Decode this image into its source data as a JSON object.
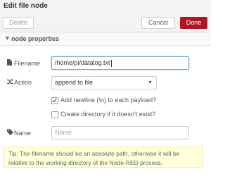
{
  "header": {
    "title": "Edit file node"
  },
  "toolbar": {
    "delete_label": "Delete",
    "cancel_label": "Cancel",
    "done_label": "Done"
  },
  "section": {
    "title": "node properties"
  },
  "form": {
    "filename": {
      "label": "Filename",
      "value": "/home/pi/datalog.txt"
    },
    "action": {
      "label": "Action",
      "value": "append to file"
    },
    "add_newline": {
      "label": "Add newline (\\n) to each payload?",
      "checked": true
    },
    "create_dir": {
      "label": "Create directory if it doesn't exist?",
      "checked": false
    },
    "name": {
      "label": "Name",
      "placeholder": "Name",
      "value": ""
    }
  },
  "tip": {
    "text": "Tip: The filename should be an absolute path, otherwise it will be relative to the working directory of the Node-RED process."
  },
  "colors": {
    "done_button": "#ad1625",
    "tip_background": "#ffffd9"
  },
  "icons": {
    "filename": "file-icon",
    "action": "shuffle-icon",
    "name": "tag-icon",
    "section": "chevron-down-icon"
  }
}
